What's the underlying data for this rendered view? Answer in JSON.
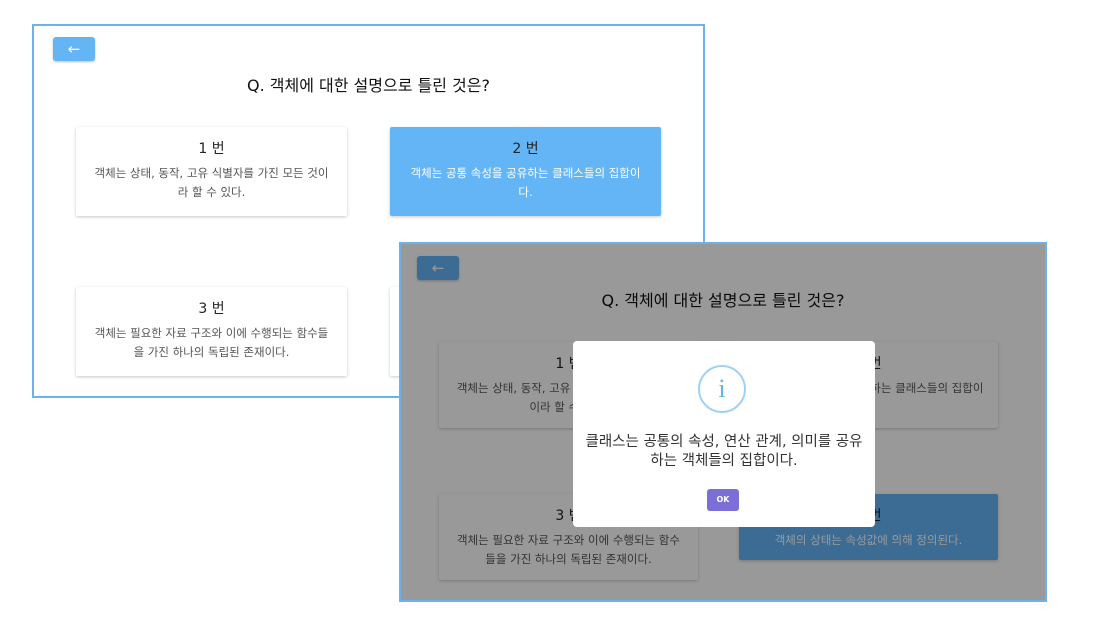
{
  "back_icon": "←",
  "question": "Q. 객체에 대한 설명으로 틀린 것은?",
  "panel_a": {
    "cards": [
      {
        "num": "1 번",
        "text": "객체는 상태, 동작, 고유 식별자를 가진 모든 것이라 할 수 있다."
      },
      {
        "num": "2 번",
        "text": "객체는 공통 속성을 공유하는 클래스들의 집합이다."
      },
      {
        "num": "3 번",
        "text": "객체는 필요한 자료 구조와 이에 수행되는 함수들을 가진 하나의 독립된 존재이다."
      },
      {
        "num": "",
        "text": ""
      }
    ]
  },
  "panel_b": {
    "cards": [
      {
        "num": "1 번",
        "text": "객체는 상태, 동작, 고유 식별자를 가진 모든 것이라 할 수 있다."
      },
      {
        "num": "2 번",
        "text": "객체는 공통 속성을 공유하는 클래스들의 집합이다."
      },
      {
        "num": "3 번",
        "text": "객체는 필요한 자료 구조와 이에 수행되는 함수들을 가진 하나의 독립된 존재이다."
      },
      {
        "num": "4 번",
        "text": "객체의 상태는 속성값에 의해 정의된다."
      }
    ],
    "dialog": {
      "icon": "i",
      "message": "클래스는 공통의 속성, 연산 관계, 의미를 공유하는 객체들의 집합이다.",
      "ok_label": "OK"
    }
  },
  "colors": {
    "accent": "#64b5f6",
    "border": "#6db0ec",
    "ok_button": "#7b6fd6",
    "info_icon": "#9fd3ef"
  }
}
